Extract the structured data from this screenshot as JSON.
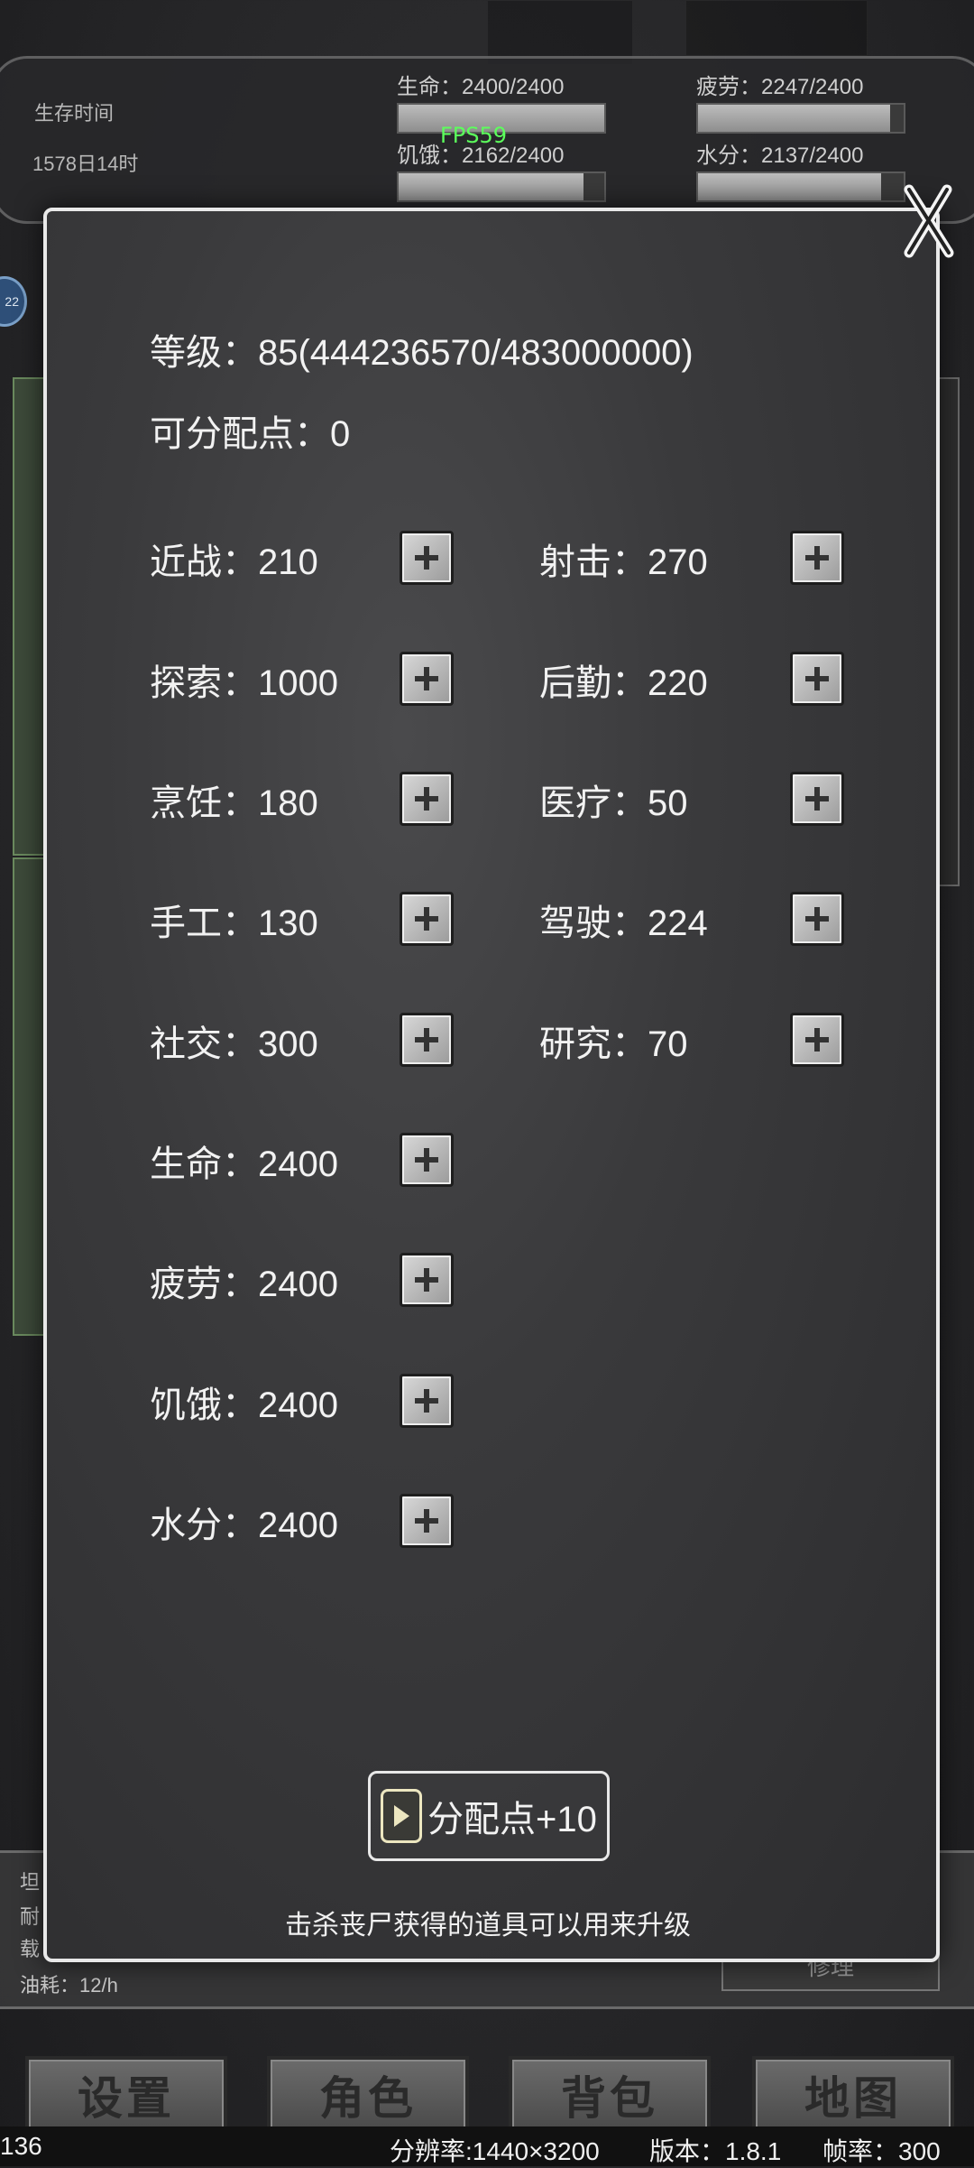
{
  "hud": {
    "survival_time_label": "生存时间",
    "survival_time_value": "1578日14时",
    "fps": "FPS59",
    "stats": [
      {
        "label": "生命：2400/2400",
        "fill": 1.0
      },
      {
        "label": "疲劳：2247/2400",
        "fill": 0.936
      },
      {
        "label": "饥饿：2162/2400",
        "fill": 0.9
      },
      {
        "label": "水分：2137/2400",
        "fill": 0.89
      }
    ],
    "side_badge": "22"
  },
  "dialog": {
    "level_text": "等级：85(444236570/483000000)",
    "points_text": "可分配点：0",
    "skills": [
      {
        "label": "近战：210"
      },
      {
        "label": "射击：270"
      },
      {
        "label": "探索：1000"
      },
      {
        "label": "后勤：220"
      },
      {
        "label": "烹饪：180"
      },
      {
        "label": "医疗：50"
      },
      {
        "label": "手工：130"
      },
      {
        "label": "驾驶：224"
      },
      {
        "label": "社交：300"
      },
      {
        "label": "研究：70"
      }
    ],
    "attributes": [
      {
        "label": "生命：2400"
      },
      {
        "label": "疲劳：2400"
      },
      {
        "label": "饥饿：2400"
      },
      {
        "label": "水分：2400"
      }
    ],
    "allocate_button": "分配点+10",
    "hint": "击杀丧尸获得的道具可以用来升级"
  },
  "vehicle": {
    "lines": [
      "坦",
      "耐",
      "载",
      "油耗：12/h"
    ],
    "repair_button": "修理"
  },
  "nav": [
    "设置",
    "角色",
    "背包",
    "地图"
  ],
  "footer": {
    "left": "136",
    "resolution": "分辨率:1440×3200",
    "version": "版本：1.8.1",
    "framerate": "帧率：300"
  },
  "colors": {
    "fps": "#5cff5c",
    "modal_border": "#e8e8e8"
  }
}
